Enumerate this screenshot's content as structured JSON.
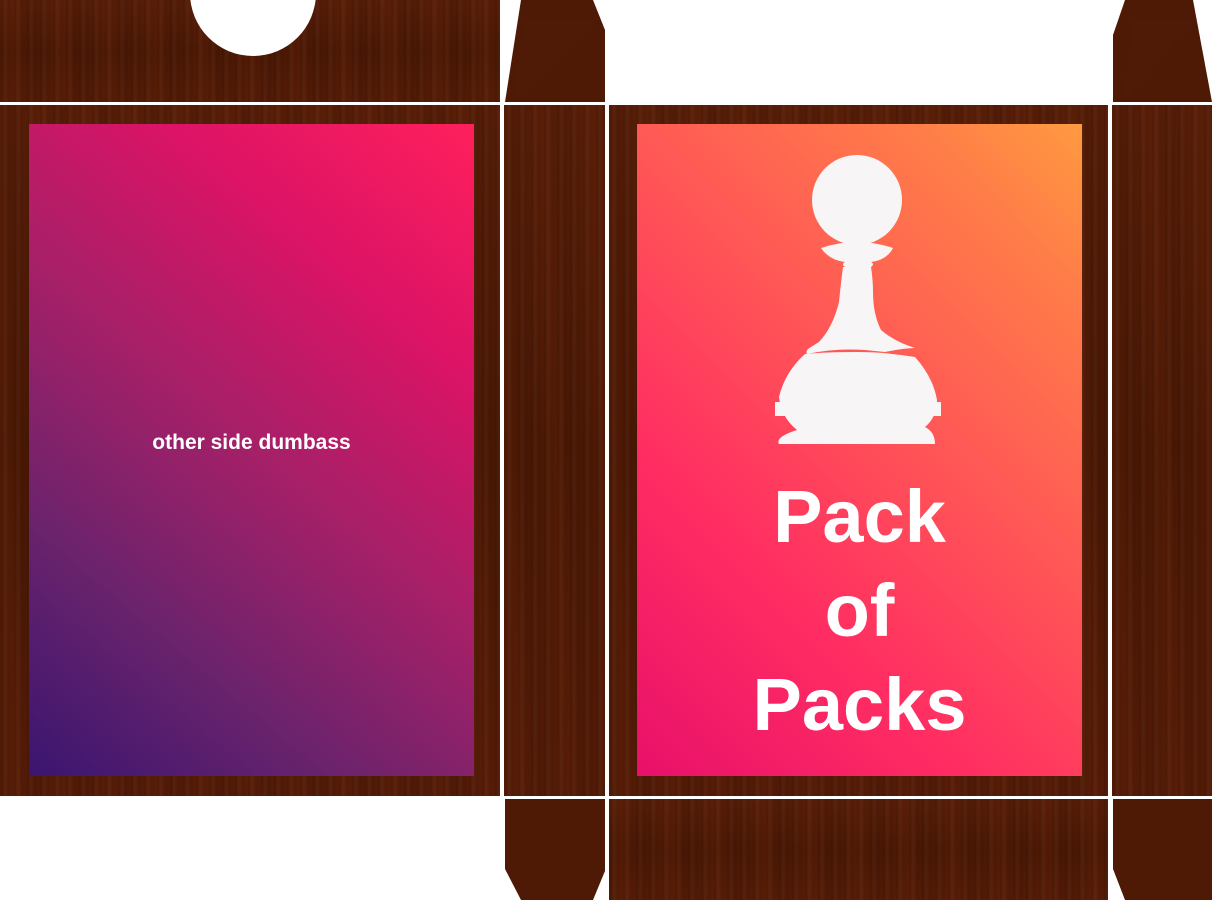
{
  "back_panel": {
    "text": "other side dumbass",
    "gradient": [
      "#3a1570",
      "#a52068",
      "#ff1f5c"
    ]
  },
  "front_panel": {
    "title_lines": [
      "Pack",
      "of",
      "Packs"
    ],
    "icon": "pawn-icon",
    "gradient": [
      "#e8106a",
      "#ff5a55",
      "#ff9a40"
    ]
  },
  "colors": {
    "wood": "#4e1a06",
    "cut_line": "#ffffff"
  }
}
